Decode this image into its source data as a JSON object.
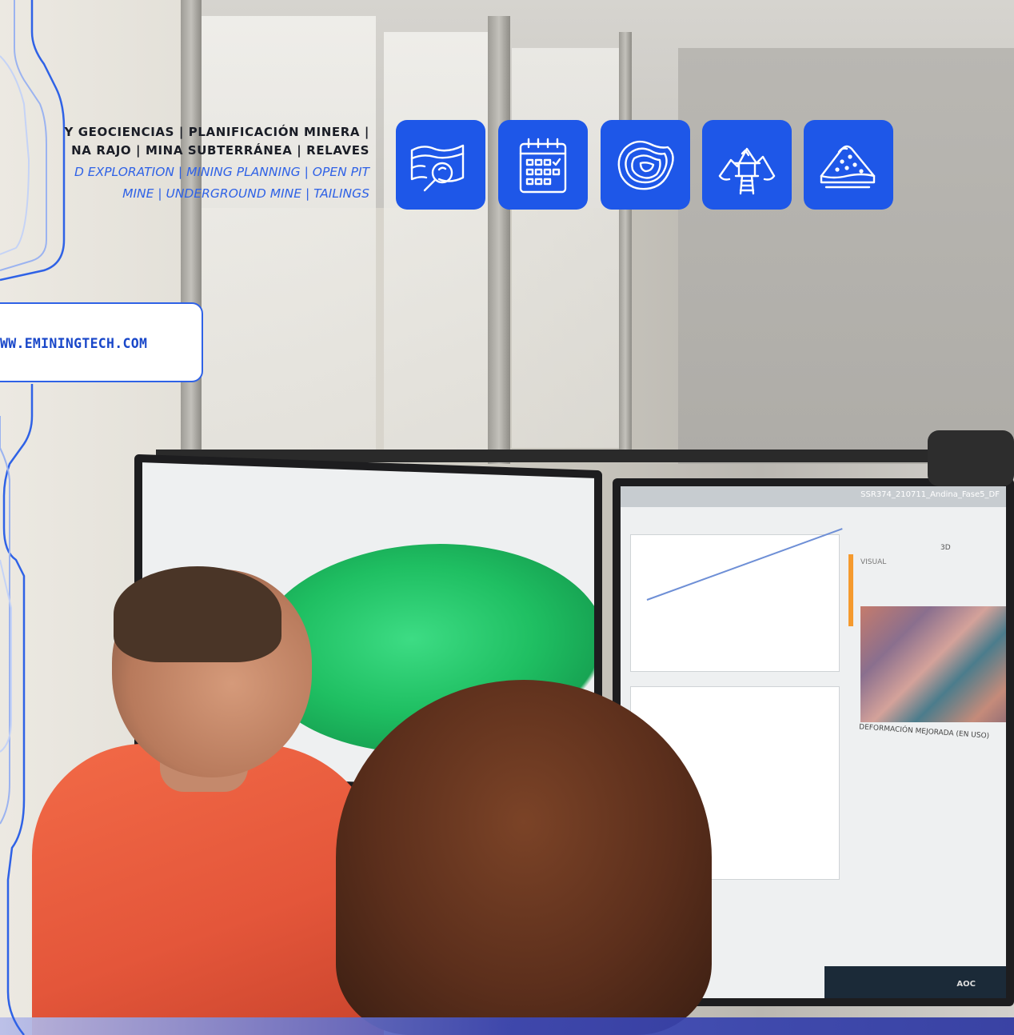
{
  "headline": {
    "spanish_line_1": "Y GEOCIENCIAS | PLANIFICACIÓN MINERA |",
    "spanish_line_2": "NA RAJO | MINA SUBTERRÁNEA | RELAVES",
    "english_line_1": "D EXPLORATION | MINING PLANNING | OPEN PIT",
    "english_line_2": "MINE | UNDERGROUND MINE | TAILINGS"
  },
  "website": {
    "label": "WW.EMININGTECH.COM"
  },
  "icons": [
    {
      "name": "exploration-map-magnifier-icon"
    },
    {
      "name": "planning-calendar-icon"
    },
    {
      "name": "open-pit-mine-icon"
    },
    {
      "name": "underground-mine-icon"
    },
    {
      "name": "tailings-pile-icon"
    }
  ],
  "monitor": {
    "window_title": "SSR374_210711_Andina_Fase5_DF",
    "panel_label_visual": "VISUAL",
    "panel_label_deformation": "DEFORMACIÓN MEJORADA (EN USO)",
    "toolbar_3d": "3D",
    "brand": "AOC"
  },
  "colors": {
    "accent_blue": "#1e57e8",
    "text_blue": "#2f62e6",
    "text_dark": "#1a1d26"
  }
}
